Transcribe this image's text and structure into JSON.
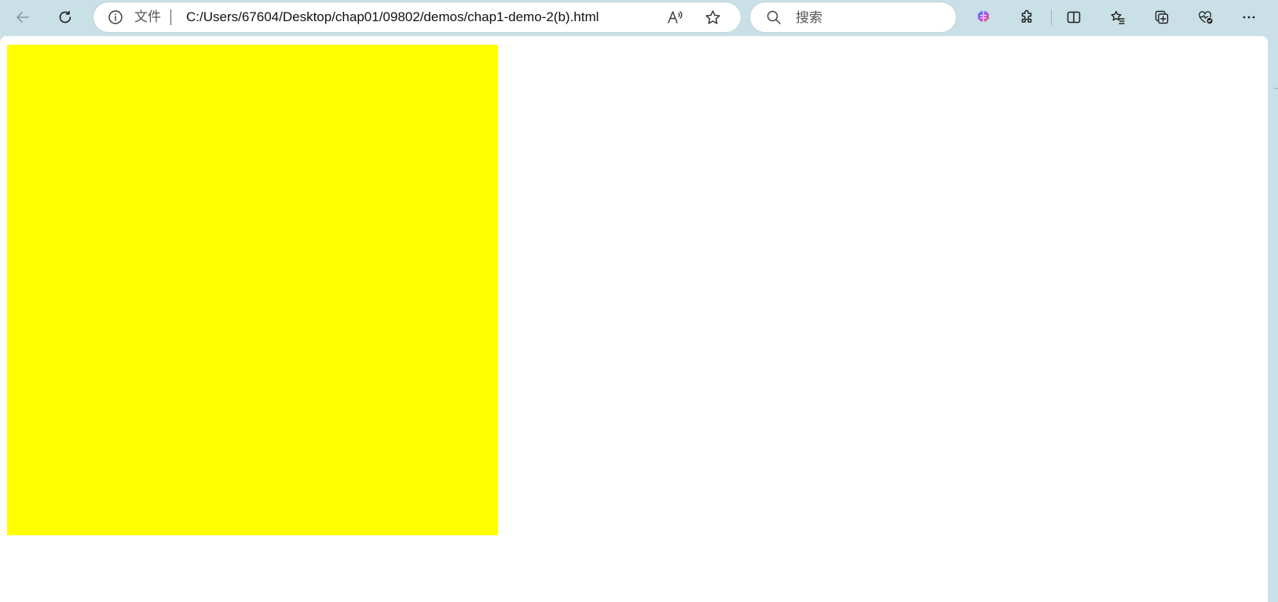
{
  "browser": {
    "address_bar": {
      "scheme_label": "文件",
      "url": "C:/Users/67604/Desktop/chap01/09802/demos/chap1-demo-2(b).html"
    },
    "search": {
      "placeholder": "搜索"
    },
    "icons": {
      "back": "back-arrow-icon",
      "refresh": "refresh-icon",
      "info": "info-icon",
      "read_aloud": "read-aloud-icon",
      "favorite": "star-icon",
      "search": "search-icon",
      "copilot": "copilot-icon",
      "extensions": "puzzle-icon",
      "split_screen": "split-screen-icon",
      "favorites": "favorites-list-icon",
      "collections": "collections-icon",
      "browser_essentials": "heart-pulse-icon",
      "menu": "more-icon"
    }
  },
  "page": {
    "box_color": "#ffff00",
    "background": "#ffffff"
  }
}
